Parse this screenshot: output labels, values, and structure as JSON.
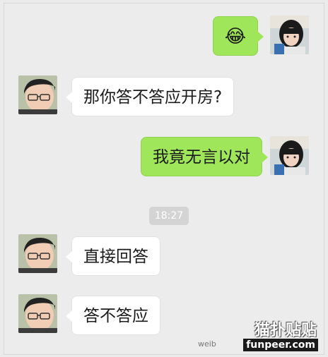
{
  "chat": {
    "messages": [
      {
        "side": "right",
        "type": "emoji",
        "emoji": "😂",
        "emoji_name": "tears-of-joy-emoji"
      },
      {
        "side": "left",
        "type": "text",
        "text": "那你答不答应开房?"
      },
      {
        "side": "right",
        "type": "text",
        "text": "我竟无言以对"
      },
      {
        "side": "left",
        "type": "text",
        "text": "直接回答"
      },
      {
        "side": "left",
        "type": "text",
        "text": "答不答应"
      }
    ],
    "timestamp": "18:27"
  },
  "watermark": {
    "site": "funpeer.com",
    "logo_text": "猫扑贴贴",
    "weibo": "weib"
  },
  "colors": {
    "background": "#ececec",
    "bubble_in": "#ffffff",
    "bubble_out": "#9fe65a",
    "timestamp_bg": "#d4d4d4"
  }
}
